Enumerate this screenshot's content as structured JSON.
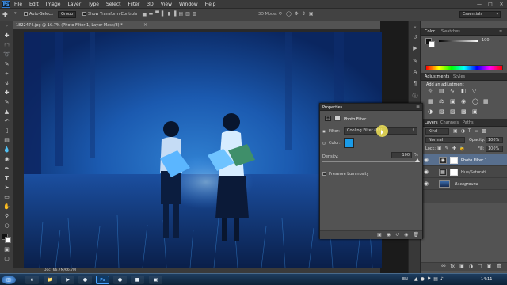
{
  "app": {
    "logo": "Ps",
    "menus": [
      "File",
      "Edit",
      "Image",
      "Layer",
      "Type",
      "Select",
      "Filter",
      "3D",
      "View",
      "Window",
      "Help"
    ]
  },
  "options": {
    "auto_select_label": "Auto-Select:",
    "auto_select_value": "Group",
    "transform_label": "Show Transform Controls",
    "mode_3d": "3D Mode:",
    "workspace": "Essentials"
  },
  "document": {
    "tab_title": "1822474.jpg @ 16.7% (Photo Filter 1, Layer Mask/8) *",
    "status": "Doc: 66.7M/66.7M"
  },
  "color_panel": {
    "tabs": [
      "Color",
      "Swatches"
    ],
    "value": "100"
  },
  "adjustments_panel": {
    "tabs": [
      "Adjustments",
      "Styles"
    ],
    "heading": "Add an adjustment"
  },
  "layers_panel": {
    "tabs": [
      "Layers",
      "Channels",
      "Paths"
    ],
    "kind_label": "Kind",
    "blend_mode": "Normal",
    "opacity_label": "Opacity:",
    "opacity": "100%",
    "lock_label": "Lock:",
    "fill_label": "Fill:",
    "fill": "100%",
    "layers": [
      {
        "name": "Photo Filter 1",
        "selected": true
      },
      {
        "name": "Hue/Saturati...",
        "selected": false
      },
      {
        "name": "Background",
        "selected": false,
        "italic": true
      }
    ]
  },
  "properties_panel": {
    "tab": "Properties",
    "title": "Photo Filter",
    "filter_label": "Filter:",
    "filter_value": "Cooling Filter (82)",
    "color_label": "Color:",
    "color_swatch": "#1a9be8",
    "density_label": "Density:",
    "density_value": "100",
    "density_unit": "%",
    "density_fraction": 1.0,
    "preserve_label": "Preserve Luminosity"
  },
  "taskbar": {
    "lang": "EN",
    "time": "14:11"
  }
}
